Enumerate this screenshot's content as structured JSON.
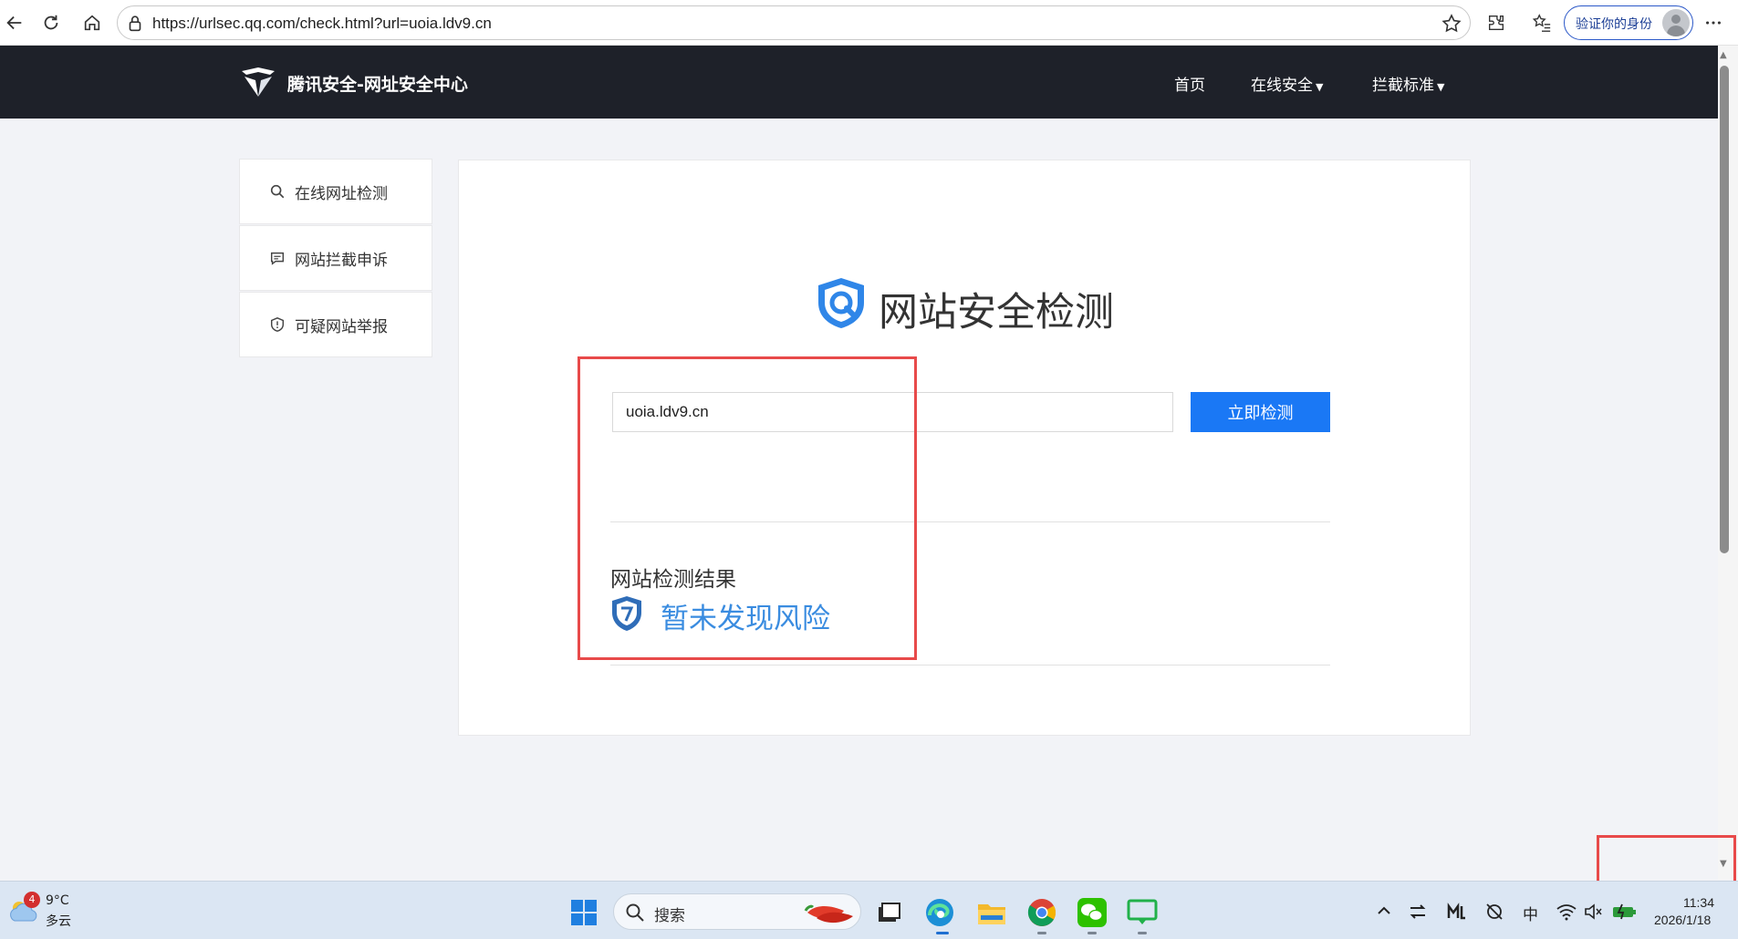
{
  "browser": {
    "url": "https://urlsec.qq.com/check.html?url=uoia.ldv9.cn",
    "profile_label": "验证你的身份"
  },
  "site": {
    "brand": "腾讯安全-网址安全中心",
    "nav": [
      {
        "label": "首页"
      },
      {
        "label": "在线安全"
      },
      {
        "label": "拦截标准"
      }
    ]
  },
  "sidebar": {
    "items": [
      {
        "label": "在线网址检测",
        "icon": "search-icon"
      },
      {
        "label": "网站拦截申诉",
        "icon": "message-icon"
      },
      {
        "label": "可疑网站举报",
        "icon": "shield-icon"
      }
    ]
  },
  "main": {
    "title": "网站安全检测",
    "input_value": "uoia.ldv9.cn",
    "check_button": "立即检测",
    "result_label": "网站检测结果",
    "result_text": "暂未发现风险"
  },
  "taskbar": {
    "weather_badge": "4",
    "weather_temp": "9°C",
    "weather_desc": "多云",
    "search_label": "搜索",
    "ime": "中",
    "time": "11:34",
    "date": "2026/1/18"
  },
  "colors": {
    "header_bg": "#1e2129",
    "accent": "#1a78f5",
    "result_blue": "#3a8ce0",
    "annotation_red": "#e84a4a"
  }
}
